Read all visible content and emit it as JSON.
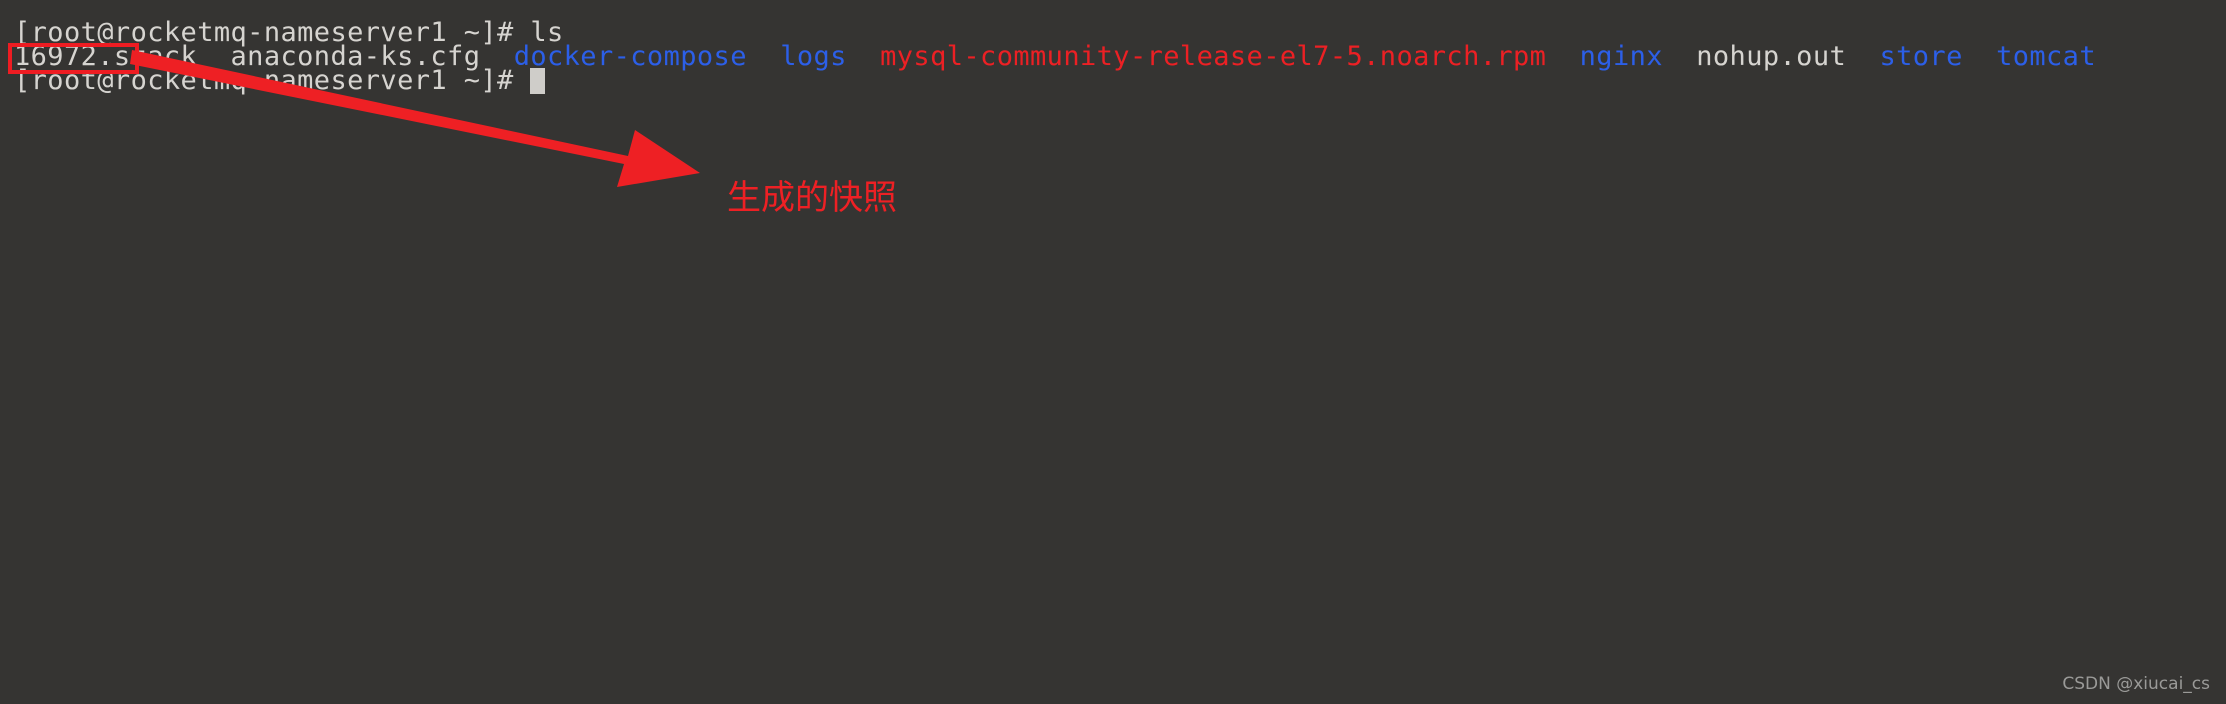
{
  "terminal": {
    "background_color": "#353432",
    "default_text_color": "#d6d4d0",
    "directory_color": "#2c5fe8",
    "archive_color": "#ec2024",
    "lines": [
      {
        "id": "line-1",
        "prompt": "[root@rocketmq-nameserver1 ~]# ",
        "command": "ls"
      },
      {
        "id": "line-2",
        "entries": [
          {
            "name": "16972.stack",
            "type": "file"
          },
          {
            "name": "anaconda-ks.cfg",
            "type": "file"
          },
          {
            "name": "docker-compose",
            "type": "directory"
          },
          {
            "name": "logs",
            "type": "directory"
          },
          {
            "name": "mysql-community-release-el7-5.noarch.rpm",
            "type": "archive"
          },
          {
            "name": "nginx",
            "type": "directory"
          },
          {
            "name": "nohup.out",
            "type": "file"
          },
          {
            "name": "store",
            "type": "directory"
          },
          {
            "name": "tomcat",
            "type": "directory"
          }
        ]
      },
      {
        "id": "line-3",
        "prompt": "[root@rocketmq-nameserver1 ~]# ",
        "command": ""
      }
    ],
    "line_1_text": "[root@rocketmq-nameserver1 ~]# ls",
    "line_3_text": "[root@rocketmq-nameserver1 ~]# "
  },
  "annotations": {
    "highlight_box": {
      "target": "16972.stack",
      "color": "#ee1c22"
    },
    "arrow": {
      "color": "#ee2024",
      "direction": "down-right"
    },
    "label": {
      "text": "生成的快照",
      "color": "#ee2024"
    }
  },
  "watermark": {
    "text": "CSDN @xiucai_cs",
    "color": "#9a9a98"
  },
  "file_entries": {
    "e0": "16972.stack",
    "gap0": "  ",
    "e1": "anaconda-ks.cfg",
    "gap1": "  ",
    "e2": "docker-compose",
    "gap2": "  ",
    "e3": "logs",
    "gap3": "  ",
    "e4": "mysql-community-release-el7-5.noarch.rpm",
    "gap4": "  ",
    "e5": "nginx",
    "gap5": "  ",
    "e6": "nohup.out",
    "gap6": "  ",
    "e7": "store",
    "gap7": "  ",
    "e8": "tomcat"
  }
}
